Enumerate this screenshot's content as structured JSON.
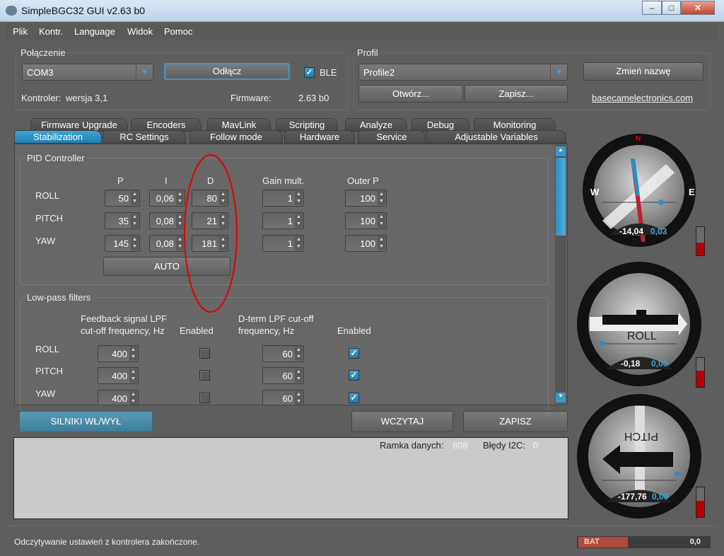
{
  "window": {
    "title": "SimpleBGC32 GUI v2.63 b0",
    "minimize": "–",
    "maximize": "□",
    "close": "✕"
  },
  "menu": [
    "Plik",
    "Kontr.",
    "Language",
    "Widok",
    "Pomoc"
  ],
  "connection": {
    "group_label": "Połączenie",
    "port": "COM3",
    "disconnect_label": "Odłącz",
    "ble_label": "BLE",
    "ble_checked": true,
    "controller_label": "Kontroler:",
    "controller_value": "wersja 3,1",
    "firmware_label": "Firmware:",
    "firmware_value": "2.63 b0"
  },
  "profile": {
    "group_label": "Profil",
    "selected": "Profile2",
    "open_label": "Otwórz...",
    "save_label": "Zapisz...",
    "rename_label": "Zmień nazwę",
    "link": "basecamelectronics.com"
  },
  "tabs_row1": [
    "Firmware Upgrade",
    "Encoders",
    "MavLink",
    "Scripting",
    "Analyze",
    "Debug",
    "Monitoring"
  ],
  "tabs_row2": [
    "Stabilization",
    "RC Settings",
    "Follow mode",
    "Hardware",
    "Service",
    "Adjustable Variables"
  ],
  "active_tab": "Stabilization",
  "pid": {
    "group_label": "PID Controller",
    "headers": [
      "P",
      "I",
      "D",
      "Gain mult.",
      "Outer P"
    ],
    "rows": [
      {
        "axis": "ROLL",
        "values": [
          "50",
          "0,06",
          "80",
          "1",
          "100"
        ]
      },
      {
        "axis": "PITCH",
        "values": [
          "35",
          "0,08",
          "21",
          "1",
          "100"
        ]
      },
      {
        "axis": "YAW",
        "values": [
          "145",
          "0,08",
          "181",
          "1",
          "100"
        ]
      }
    ],
    "auto_label": "AUTO"
  },
  "lpf": {
    "group_label": "Low-pass filters",
    "header_feedback_1": "Feedback signal LPF",
    "header_feedback_2": "cut-off frequency, Hz",
    "header_enabled": "Enabled",
    "header_dterm_1": "D-term LPF cut-off",
    "header_dterm_2": "frequency, Hz",
    "header_enabled2": "Enabled",
    "rows": [
      {
        "axis": "ROLL",
        "feedback": "400",
        "feedback_enabled": false,
        "dterm": "60",
        "dterm_enabled": true
      },
      {
        "axis": "PITCH",
        "feedback": "400",
        "feedback_enabled": false,
        "dterm": "60",
        "dterm_enabled": true
      },
      {
        "axis": "YAW",
        "feedback": "400",
        "feedback_enabled": false,
        "dterm": "60",
        "dterm_enabled": true
      }
    ]
  },
  "actions": {
    "motors_label": "SILNIKI WŁ/WYŁ",
    "read_label": "WCZYTAJ",
    "write_label": "ZAPISZ"
  },
  "log": {
    "frame_label": "Ramka danych:",
    "frame_value": "808",
    "i2c_label": "Błędy I2C:",
    "i2c_value": "0"
  },
  "status": {
    "message": "Odczytywanie ustawień z kontrolera zakończone.",
    "bat_label": "BAT",
    "bat_value": "0,0"
  },
  "gauges": {
    "yaw": {
      "n": "N",
      "w": "W",
      "e": "E",
      "angle": "-14,04",
      "rate": "0,03",
      "level_pct": 45
    },
    "roll": {
      "label": "ROLL",
      "angle": "-0,18",
      "rate": "0,00",
      "level_pct": 55
    },
    "pitch": {
      "label": "PITCH",
      "angle": "-177,76",
      "rate": "0,00",
      "level_pct": 55
    }
  },
  "colors": {
    "accent": "#2a8fc6",
    "annotation": "#e00000",
    "level": "#b40000"
  }
}
